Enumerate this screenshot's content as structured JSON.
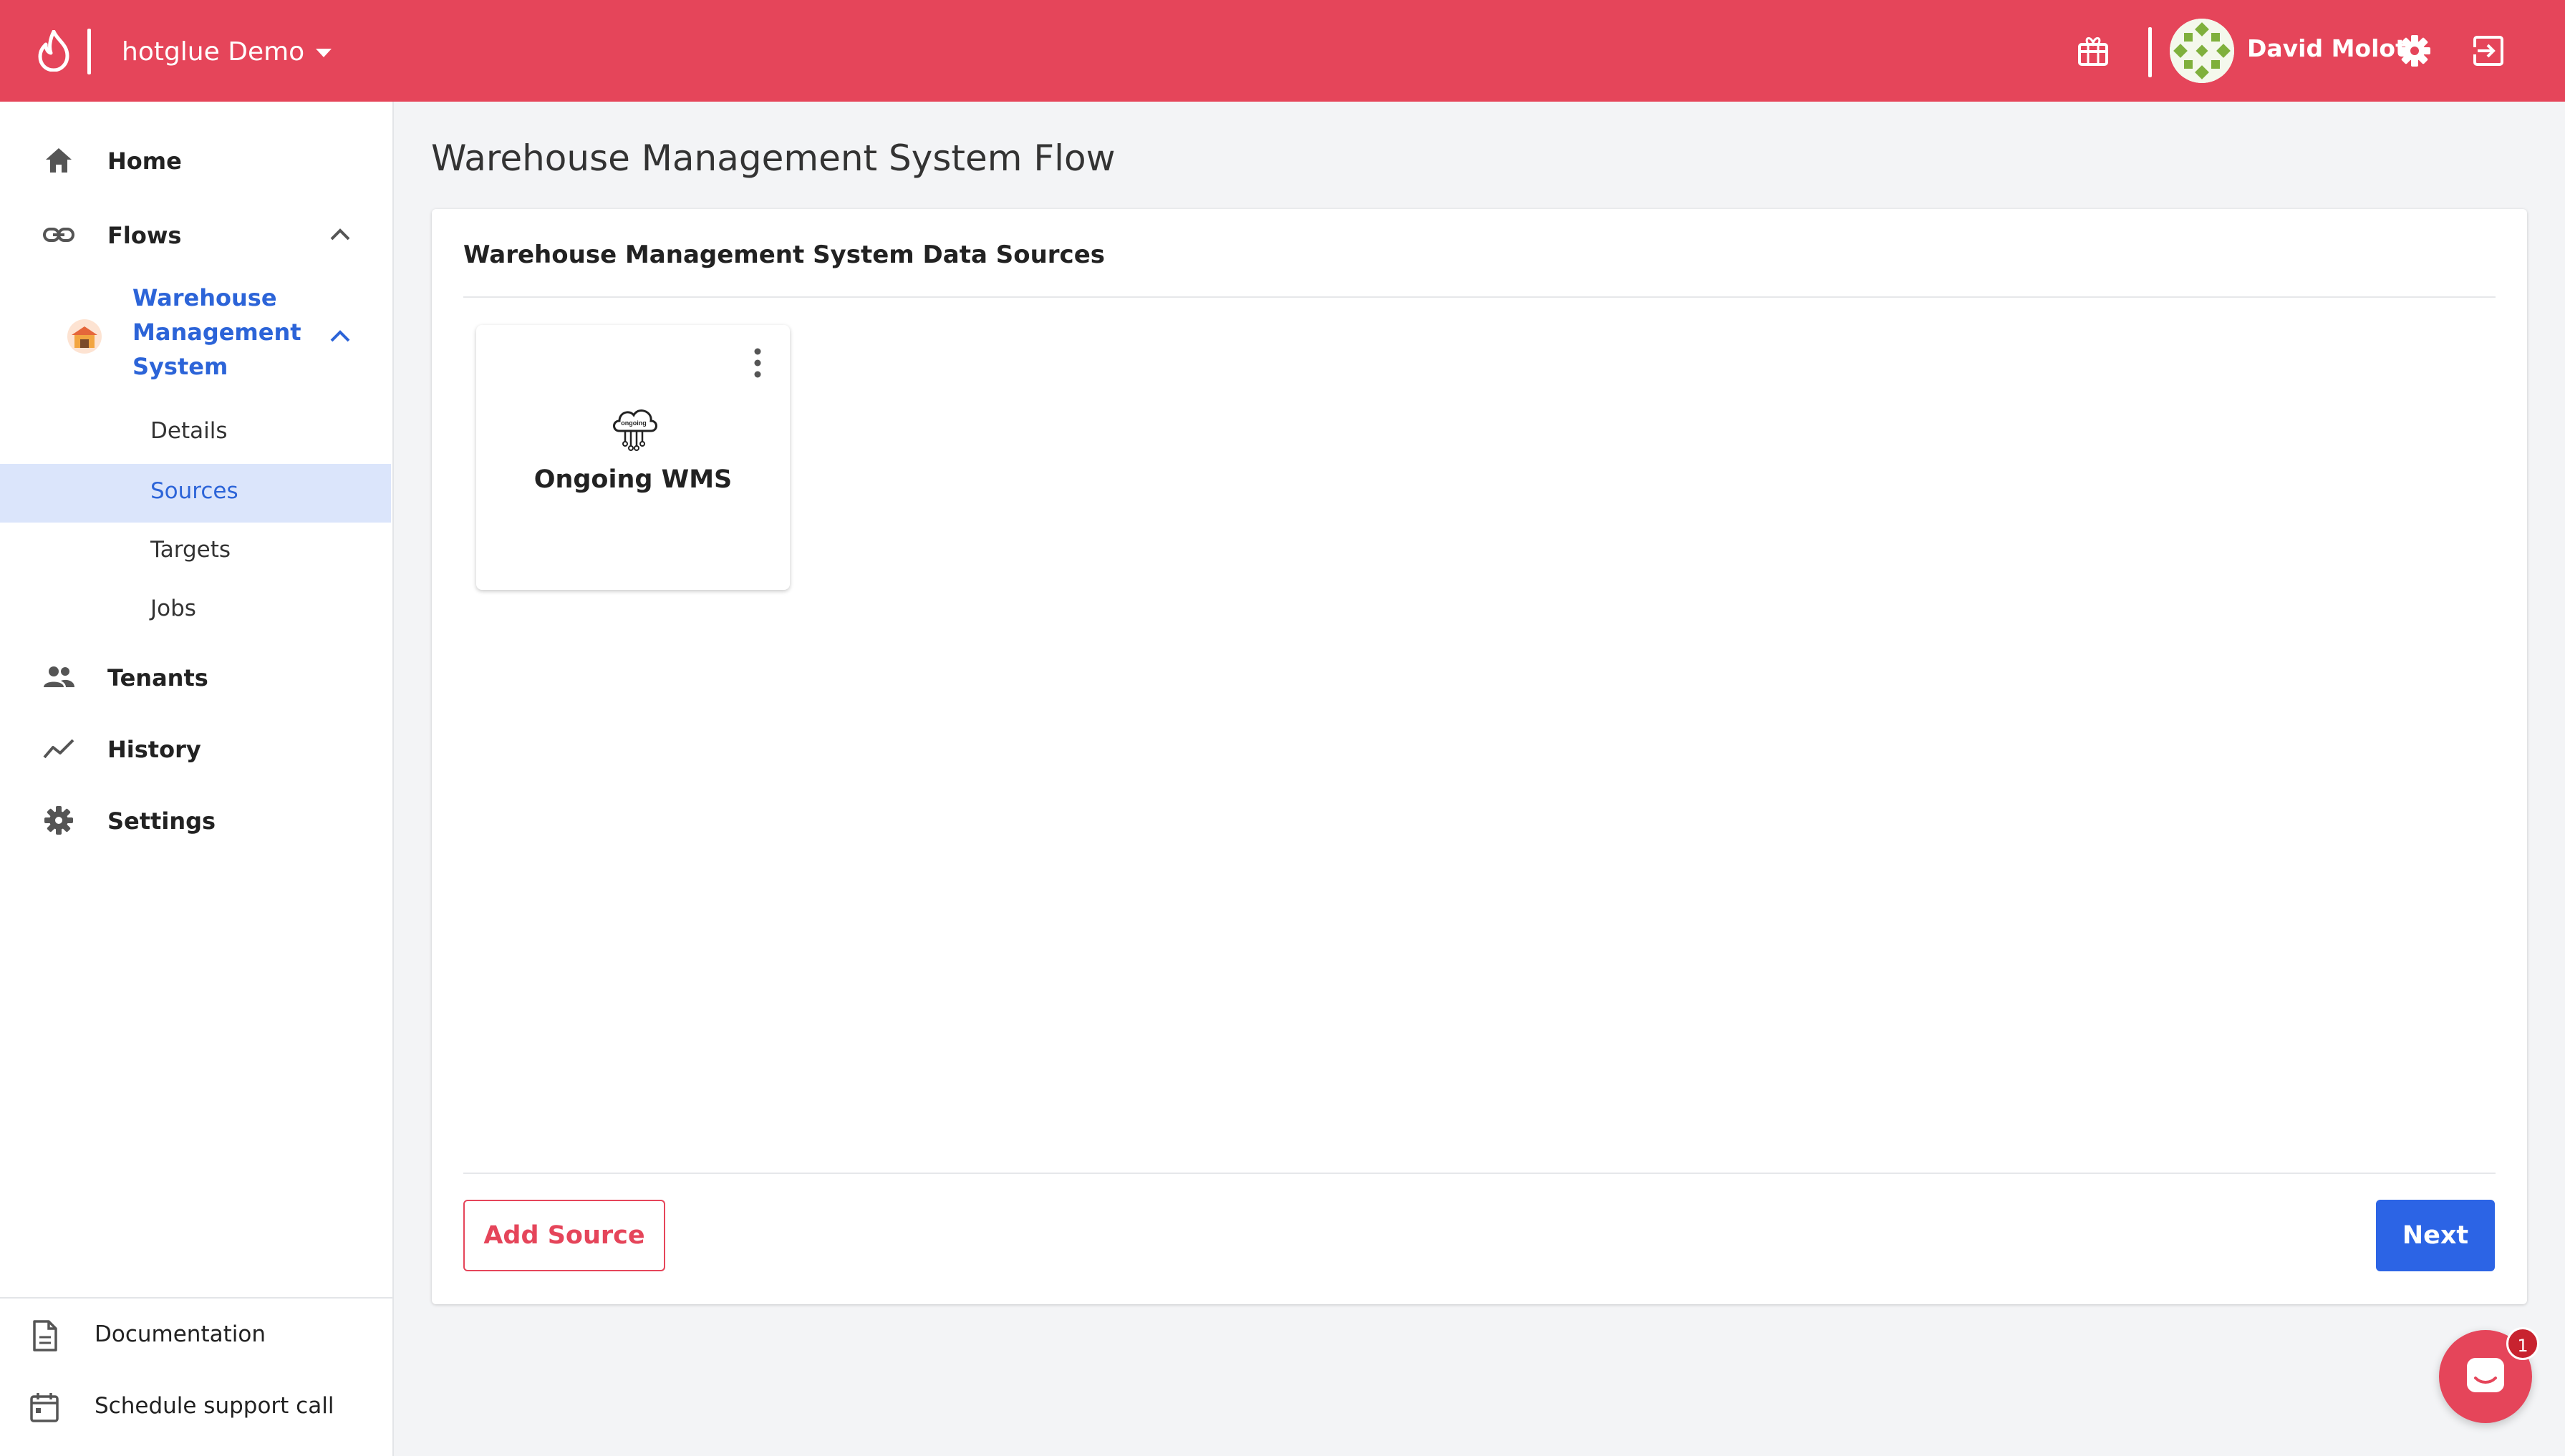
{
  "header": {
    "org_name": "hotglue Demo",
    "user_name": "David Molot",
    "icons": [
      "flame-logo",
      "gift-icon",
      "avatar",
      "gear-icon",
      "logout-icon"
    ]
  },
  "sidebar": {
    "home": "Home",
    "flows": "Flows",
    "flow_active": {
      "label_lines": [
        "Warehouse",
        "Management",
        "System"
      ],
      "sub_items": [
        {
          "label": "Details",
          "active": false
        },
        {
          "label": "Sources",
          "active": true
        },
        {
          "label": "Targets",
          "active": false
        },
        {
          "label": "Jobs",
          "active": false
        }
      ]
    },
    "tenants": "Tenants",
    "history": "History",
    "settings": "Settings",
    "footer": {
      "documentation": "Documentation",
      "support": "Schedule support call"
    }
  },
  "main": {
    "page_title": "Warehouse Management System Flow",
    "card_title": "Warehouse Management System Data Sources",
    "sources": [
      {
        "label": "Ongoing WMS",
        "logo_text": "ongoing"
      }
    ],
    "add_source_label": "Add Source",
    "next_label": "Next"
  },
  "chat": {
    "badge_count": "1"
  },
  "colors": {
    "brand": "#e5455a",
    "primary": "#2c64e5",
    "active_bg": "#dbe5fb",
    "active_text": "#2c64d8"
  }
}
